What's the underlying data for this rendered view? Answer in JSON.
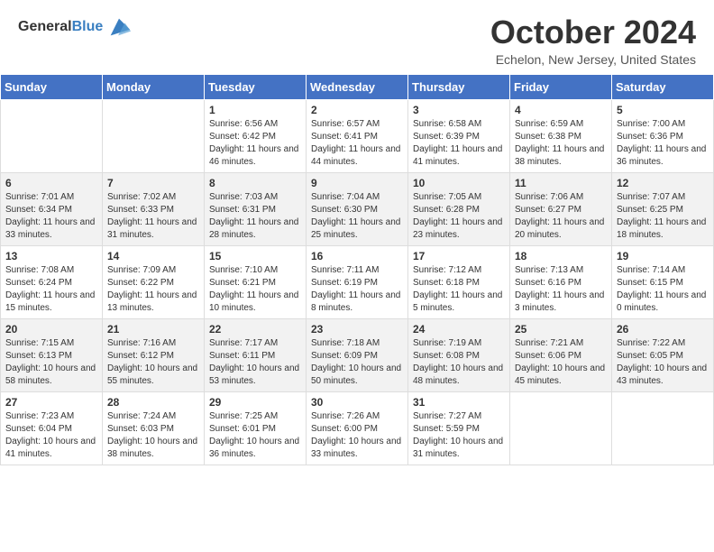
{
  "header": {
    "logo_general": "General",
    "logo_blue": "Blue",
    "month_title": "October 2024",
    "location": "Echelon, New Jersey, United States"
  },
  "weekdays": [
    "Sunday",
    "Monday",
    "Tuesday",
    "Wednesday",
    "Thursday",
    "Friday",
    "Saturday"
  ],
  "weeks": [
    [
      {
        "day": "",
        "sunrise": "",
        "sunset": "",
        "daylight": ""
      },
      {
        "day": "",
        "sunrise": "",
        "sunset": "",
        "daylight": ""
      },
      {
        "day": "1",
        "sunrise": "Sunrise: 6:56 AM",
        "sunset": "Sunset: 6:42 PM",
        "daylight": "Daylight: 11 hours and 46 minutes."
      },
      {
        "day": "2",
        "sunrise": "Sunrise: 6:57 AM",
        "sunset": "Sunset: 6:41 PM",
        "daylight": "Daylight: 11 hours and 44 minutes."
      },
      {
        "day": "3",
        "sunrise": "Sunrise: 6:58 AM",
        "sunset": "Sunset: 6:39 PM",
        "daylight": "Daylight: 11 hours and 41 minutes."
      },
      {
        "day": "4",
        "sunrise": "Sunrise: 6:59 AM",
        "sunset": "Sunset: 6:38 PM",
        "daylight": "Daylight: 11 hours and 38 minutes."
      },
      {
        "day": "5",
        "sunrise": "Sunrise: 7:00 AM",
        "sunset": "Sunset: 6:36 PM",
        "daylight": "Daylight: 11 hours and 36 minutes."
      }
    ],
    [
      {
        "day": "6",
        "sunrise": "Sunrise: 7:01 AM",
        "sunset": "Sunset: 6:34 PM",
        "daylight": "Daylight: 11 hours and 33 minutes."
      },
      {
        "day": "7",
        "sunrise": "Sunrise: 7:02 AM",
        "sunset": "Sunset: 6:33 PM",
        "daylight": "Daylight: 11 hours and 31 minutes."
      },
      {
        "day": "8",
        "sunrise": "Sunrise: 7:03 AM",
        "sunset": "Sunset: 6:31 PM",
        "daylight": "Daylight: 11 hours and 28 minutes."
      },
      {
        "day": "9",
        "sunrise": "Sunrise: 7:04 AM",
        "sunset": "Sunset: 6:30 PM",
        "daylight": "Daylight: 11 hours and 25 minutes."
      },
      {
        "day": "10",
        "sunrise": "Sunrise: 7:05 AM",
        "sunset": "Sunset: 6:28 PM",
        "daylight": "Daylight: 11 hours and 23 minutes."
      },
      {
        "day": "11",
        "sunrise": "Sunrise: 7:06 AM",
        "sunset": "Sunset: 6:27 PM",
        "daylight": "Daylight: 11 hours and 20 minutes."
      },
      {
        "day": "12",
        "sunrise": "Sunrise: 7:07 AM",
        "sunset": "Sunset: 6:25 PM",
        "daylight": "Daylight: 11 hours and 18 minutes."
      }
    ],
    [
      {
        "day": "13",
        "sunrise": "Sunrise: 7:08 AM",
        "sunset": "Sunset: 6:24 PM",
        "daylight": "Daylight: 11 hours and 15 minutes."
      },
      {
        "day": "14",
        "sunrise": "Sunrise: 7:09 AM",
        "sunset": "Sunset: 6:22 PM",
        "daylight": "Daylight: 11 hours and 13 minutes."
      },
      {
        "day": "15",
        "sunrise": "Sunrise: 7:10 AM",
        "sunset": "Sunset: 6:21 PM",
        "daylight": "Daylight: 11 hours and 10 minutes."
      },
      {
        "day": "16",
        "sunrise": "Sunrise: 7:11 AM",
        "sunset": "Sunset: 6:19 PM",
        "daylight": "Daylight: 11 hours and 8 minutes."
      },
      {
        "day": "17",
        "sunrise": "Sunrise: 7:12 AM",
        "sunset": "Sunset: 6:18 PM",
        "daylight": "Daylight: 11 hours and 5 minutes."
      },
      {
        "day": "18",
        "sunrise": "Sunrise: 7:13 AM",
        "sunset": "Sunset: 6:16 PM",
        "daylight": "Daylight: 11 hours and 3 minutes."
      },
      {
        "day": "19",
        "sunrise": "Sunrise: 7:14 AM",
        "sunset": "Sunset: 6:15 PM",
        "daylight": "Daylight: 11 hours and 0 minutes."
      }
    ],
    [
      {
        "day": "20",
        "sunrise": "Sunrise: 7:15 AM",
        "sunset": "Sunset: 6:13 PM",
        "daylight": "Daylight: 10 hours and 58 minutes."
      },
      {
        "day": "21",
        "sunrise": "Sunrise: 7:16 AM",
        "sunset": "Sunset: 6:12 PM",
        "daylight": "Daylight: 10 hours and 55 minutes."
      },
      {
        "day": "22",
        "sunrise": "Sunrise: 7:17 AM",
        "sunset": "Sunset: 6:11 PM",
        "daylight": "Daylight: 10 hours and 53 minutes."
      },
      {
        "day": "23",
        "sunrise": "Sunrise: 7:18 AM",
        "sunset": "Sunset: 6:09 PM",
        "daylight": "Daylight: 10 hours and 50 minutes."
      },
      {
        "day": "24",
        "sunrise": "Sunrise: 7:19 AM",
        "sunset": "Sunset: 6:08 PM",
        "daylight": "Daylight: 10 hours and 48 minutes."
      },
      {
        "day": "25",
        "sunrise": "Sunrise: 7:21 AM",
        "sunset": "Sunset: 6:06 PM",
        "daylight": "Daylight: 10 hours and 45 minutes."
      },
      {
        "day": "26",
        "sunrise": "Sunrise: 7:22 AM",
        "sunset": "Sunset: 6:05 PM",
        "daylight": "Daylight: 10 hours and 43 minutes."
      }
    ],
    [
      {
        "day": "27",
        "sunrise": "Sunrise: 7:23 AM",
        "sunset": "Sunset: 6:04 PM",
        "daylight": "Daylight: 10 hours and 41 minutes."
      },
      {
        "day": "28",
        "sunrise": "Sunrise: 7:24 AM",
        "sunset": "Sunset: 6:03 PM",
        "daylight": "Daylight: 10 hours and 38 minutes."
      },
      {
        "day": "29",
        "sunrise": "Sunrise: 7:25 AM",
        "sunset": "Sunset: 6:01 PM",
        "daylight": "Daylight: 10 hours and 36 minutes."
      },
      {
        "day": "30",
        "sunrise": "Sunrise: 7:26 AM",
        "sunset": "Sunset: 6:00 PM",
        "daylight": "Daylight: 10 hours and 33 minutes."
      },
      {
        "day": "31",
        "sunrise": "Sunrise: 7:27 AM",
        "sunset": "Sunset: 5:59 PM",
        "daylight": "Daylight: 10 hours and 31 minutes."
      },
      {
        "day": "",
        "sunrise": "",
        "sunset": "",
        "daylight": ""
      },
      {
        "day": "",
        "sunrise": "",
        "sunset": "",
        "daylight": ""
      }
    ]
  ]
}
